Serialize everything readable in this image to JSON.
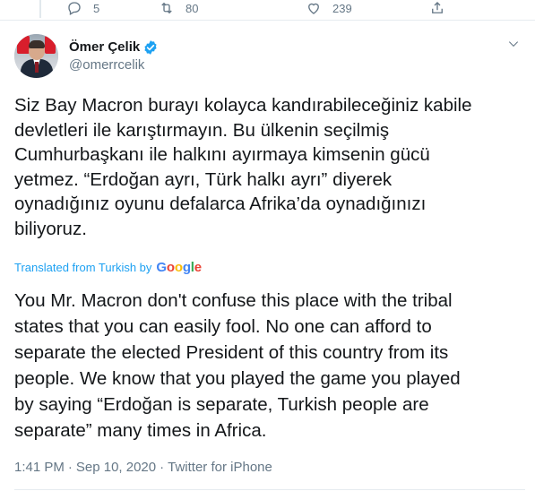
{
  "actions": {
    "reply_count": "5",
    "retweet_count": "80",
    "like_count": "239"
  },
  "author": {
    "display_name": "Ömer Çelik",
    "handle": "@omerrcelik",
    "verified": true
  },
  "tweet": {
    "text": "Siz Bay Macron burayı kolayca kandırabileceğiniz kabile\ndevletleri ile karıştırmayın. Bu ülkenin seçilmiş\nCumhurbaşkanı ile halkını ayırmaya kimsenin gücü\nyetmez. “Erdoğan ayrı, Türk halkı ayrı” diyerek\noynadığınız oyunu defalarca Afrika’da oynadığınızı\nbiliyoruz.",
    "translated_label": "Translated from Turkish by",
    "translation": "You Mr. Macron don't confuse this place with the tribal\nstates that you can easily fool. No one can afford to\nseparate the elected President of this country from its\npeople. We know that you played the game you played\nby saying “Erdoğan is separate, Turkish people are\nseparate” many times in Africa."
  },
  "google_logo": [
    "G",
    "o",
    "o",
    "g",
    "l",
    "e"
  ],
  "meta": {
    "time": "1:41 PM",
    "separator1": "·",
    "date": "Sep 10, 2020",
    "separator2": "·",
    "source": "Twitter for iPhone"
  },
  "colors": {
    "link": "#1da1f2",
    "muted": "#657786",
    "text": "#14171a"
  },
  "icons": [
    "reply-icon",
    "retweet-icon",
    "like-icon",
    "share-icon",
    "verified-badge-icon",
    "chevron-down-icon"
  ]
}
